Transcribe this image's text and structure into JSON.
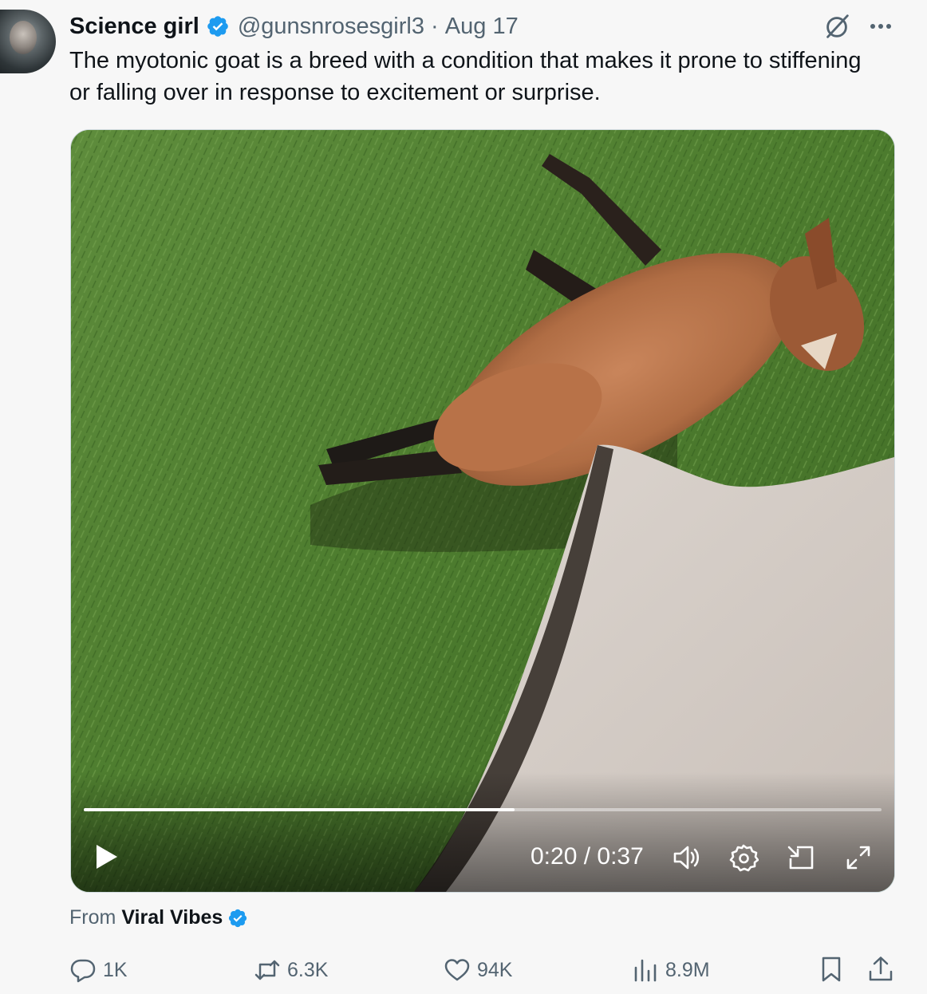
{
  "tweet": {
    "author_name": "Science girl",
    "handle": "@gunsnrosesgirl3",
    "date": "Aug 17",
    "separator": "·",
    "text": "The myotonic goat is a breed with a condition that makes it prone to stiffening or falling over in response to excitement or surprise."
  },
  "video": {
    "current_time": "0:20",
    "duration": "0:37",
    "time_separator": " / ",
    "progress_fraction": 0.54
  },
  "attribution": {
    "prefix": "From",
    "source": "Viral Vibes"
  },
  "actions": {
    "replies": "1K",
    "reposts": "6.3K",
    "likes": "94K",
    "views": "8.9M"
  },
  "colors": {
    "verified_blue": "#1d9bf0",
    "secondary_text": "#536471",
    "primary_text": "#0f1419"
  },
  "icons": {
    "verified": "verified-badge-icon",
    "grok": "grok-icon",
    "more": "more-icon",
    "play": "play-icon",
    "volume": "volume-icon",
    "settings": "settings-icon",
    "pip": "pip-icon",
    "fullscreen": "fullscreen-icon",
    "reply": "reply-icon",
    "repost": "repost-icon",
    "like": "like-icon",
    "views": "views-icon",
    "bookmark": "bookmark-icon",
    "share": "share-icon"
  }
}
